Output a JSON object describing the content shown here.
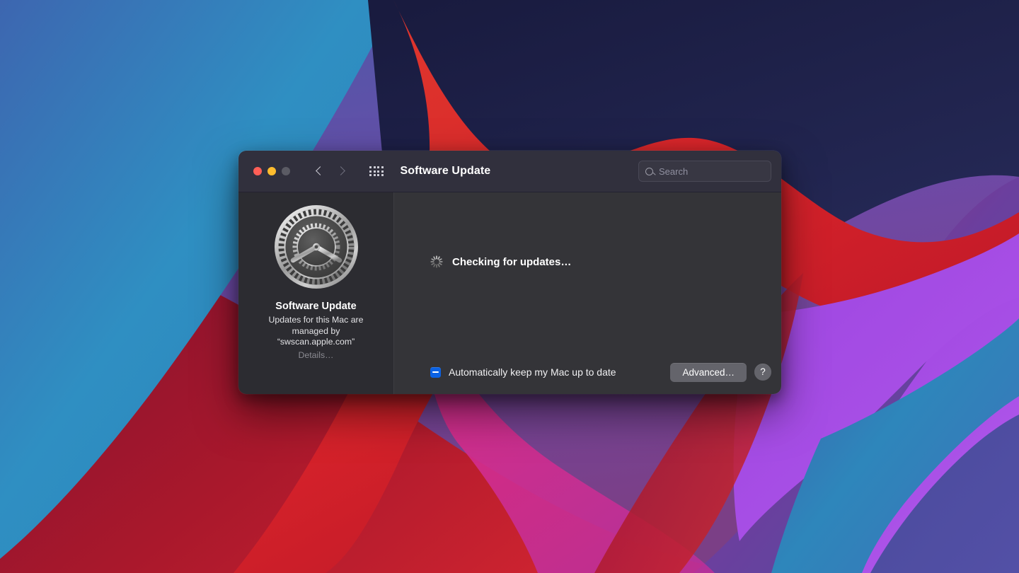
{
  "desktop": {
    "wallpaper_name": "big-sur-waves",
    "colors": {
      "blue": "#2d8fc0",
      "navy": "#1d1f44",
      "red": "#d8232a",
      "magenta": "#e0338f",
      "purple": "#a54de0",
      "indigo": "#4a4a9e",
      "darkred": "#7e0f23"
    }
  },
  "window": {
    "titlebar": {
      "traffic_lights": [
        {
          "name": "close",
          "color": "#ff5f57"
        },
        {
          "name": "minimize",
          "color": "#febc2e"
        },
        {
          "name": "zoom",
          "color": "#5b5b64"
        }
      ],
      "back_icon": "chevron-left-icon",
      "forward_icon": "chevron-right-icon",
      "grid_icon": "grid-apps-icon",
      "title": "Software Update",
      "search": {
        "icon": "search-icon",
        "placeholder": "Search",
        "value": ""
      }
    },
    "sidebar": {
      "icon": "system-preferences-gear-icon",
      "title": "Software Update",
      "description": "Updates for this Mac are managed by “swscan.apple.com”",
      "details_link": "Details…"
    },
    "content": {
      "spinner_icon": "loading-spinner-icon",
      "status": "Checking for updates…",
      "footer": {
        "checkbox_state": "mixed",
        "checkbox_color": "#0b62e4",
        "checkbox_label": "Automatically keep my Mac up to date",
        "advanced_label": "Advanced…",
        "help_label": "?"
      }
    }
  }
}
